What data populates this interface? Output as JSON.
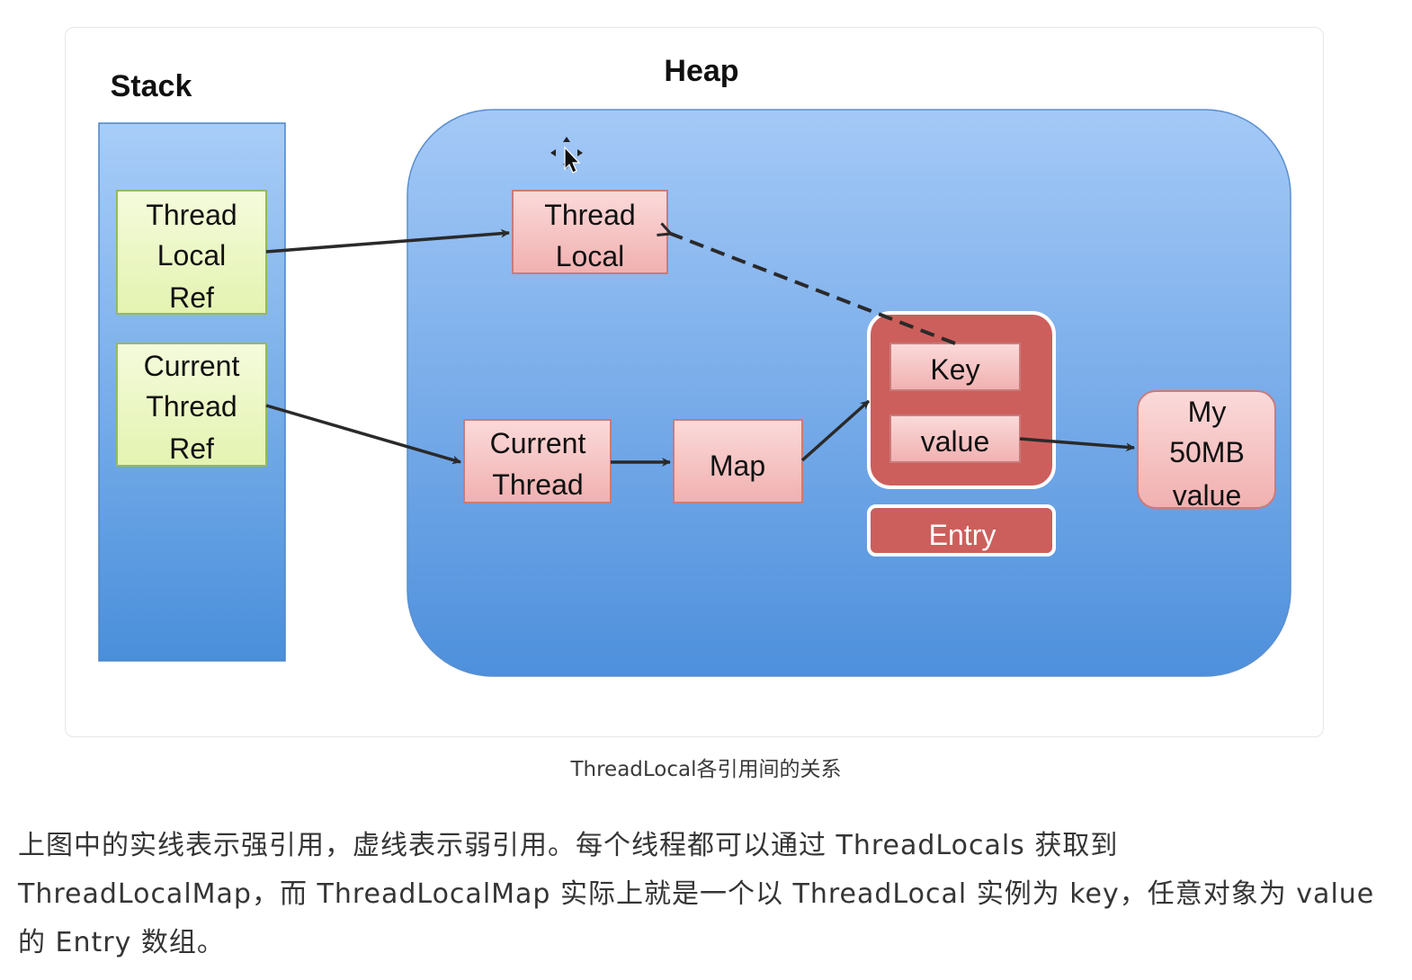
{
  "diagram": {
    "stack_title": "Stack",
    "heap_title": "Heap",
    "stack_items": [
      [
        "Thread",
        "Local",
        "Ref"
      ],
      [
        "Current",
        "Thread",
        "Ref"
      ]
    ],
    "heap_nodes": {
      "thread_local": [
        "Thread",
        "Local"
      ],
      "current_thread": [
        "Current",
        "Thread"
      ],
      "map": "Map",
      "entry_key": "Key",
      "entry_value": "value",
      "entry_label": "Entry",
      "my_value": [
        "My",
        "50MB",
        "value"
      ]
    },
    "edges": [
      {
        "from": "Thread Local Ref",
        "to": "Thread Local",
        "style": "solid"
      },
      {
        "from": "Current Thread Ref",
        "to": "Current Thread",
        "style": "solid"
      },
      {
        "from": "Current Thread",
        "to": "Map",
        "style": "solid"
      },
      {
        "from": "Map",
        "to": "Entry",
        "style": "solid"
      },
      {
        "from": "value",
        "to": "My 50MB value",
        "style": "solid"
      },
      {
        "from": "Key",
        "to": "Thread Local",
        "style": "dashed"
      }
    ],
    "colors": {
      "stack_fill": "#5f9be0",
      "heap_fill": "#6ba6e8",
      "stack_item_fill": "#eef8c6",
      "node_fill": "#f5c2c2",
      "entry_fill": "#cc5f5c"
    }
  },
  "caption": "ThreadLocal各引用间的关系",
  "paragraph": "上图中的实线表示强引用，虚线表示弱引用。每个线程都可以通过 ThreadLocals 获取到 ThreadLocalMap，而 ThreadLocalMap 实际上就是一个以 ThreadLocal 实例为 key，任意对象为 value 的 Entry 数组。"
}
